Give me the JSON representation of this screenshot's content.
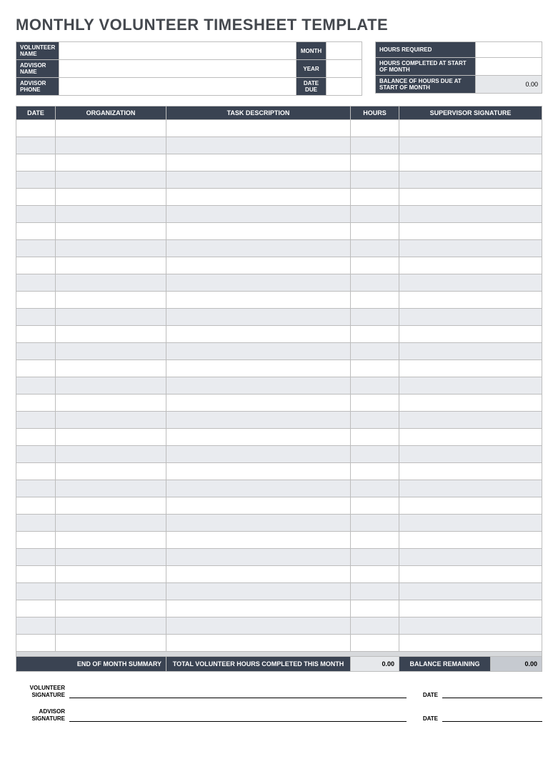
{
  "title": "MONTHLY VOLUNTEER TIMESHEET TEMPLATE",
  "info_left": {
    "volunteer_name_label": "VOLUNTEER NAME",
    "advisor_name_label": "ADVISOR NAME",
    "advisor_phone_label": "ADVISOR PHONE",
    "month_label": "MONTH",
    "year_label": "YEAR",
    "date_due_label": "DATE DUE",
    "volunteer_name": "",
    "advisor_name": "",
    "advisor_phone": "",
    "month": "",
    "year": "",
    "date_due": ""
  },
  "info_right": {
    "hours_required_label": "HOURS REQUIRED",
    "hours_completed_label": "HOURS COMPLETED AT START OF MONTH",
    "balance_due_label": "BALANCE OF HOURS DUE AT START OF MONTH",
    "hours_required": "",
    "hours_completed": "",
    "balance_due": "0.00"
  },
  "columns": {
    "date": "DATE",
    "organization": "ORGANIZATION",
    "task_description": "TASK DESCRIPTION",
    "hours": "HOURS",
    "supervisor_signature": "SUPERVISOR SIGNATURE"
  },
  "row_count": 31,
  "summary": {
    "end_of_month_label": "END OF MONTH SUMMARY",
    "total_hours_label": "TOTAL VOLUNTEER HOURS COMPLETED THIS MONTH",
    "total_hours_value": "0.00",
    "balance_remaining_label": "BALANCE REMAINING",
    "balance_remaining_value": "0.00"
  },
  "sign": {
    "volunteer_signature_label": "VOLUNTEER SIGNATURE",
    "advisor_signature_label": "ADVISOR SIGNATURE",
    "date_label": "DATE"
  }
}
